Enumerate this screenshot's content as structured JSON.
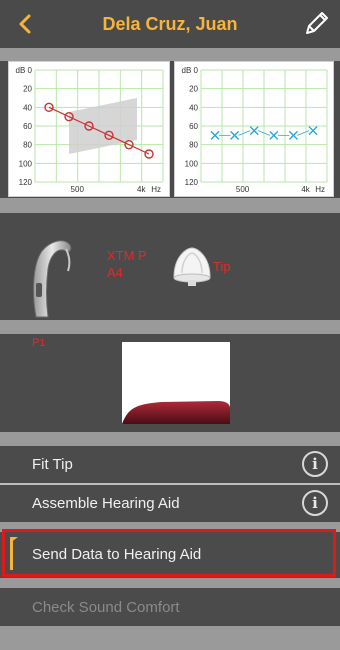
{
  "header": {
    "title": "Dela Cruz, Juan",
    "back_icon": "chevron-left-icon",
    "edit_icon": "pencil-icon",
    "accent": "#f6b43c"
  },
  "audiogram_left": {
    "y_ticks": [
      "dB 0",
      "20",
      "40",
      "60",
      "80",
      "100",
      "120"
    ],
    "x_ticks": [
      "500",
      "4k",
      "Hz"
    ],
    "marker": "circle",
    "color": "#cc3333",
    "points_db": [
      40,
      50,
      60,
      70,
      80,
      90
    ]
  },
  "audiogram_right": {
    "y_ticks": [
      "dB 0",
      "20",
      "40",
      "60",
      "80",
      "100",
      "120"
    ],
    "x_ticks": [
      "500",
      "4k",
      "Hz"
    ],
    "marker": "cross",
    "color": "#2aa8d8",
    "points_db": [
      70,
      70,
      65,
      70,
      70,
      65
    ]
  },
  "device": {
    "model_line1": "XTM P",
    "model_line2": "A4",
    "tip_label": "Tip"
  },
  "program": {
    "label": "P1"
  },
  "menu": {
    "items": [
      {
        "label": "Fit Tip",
        "info": "i"
      },
      {
        "label": "Assemble Hearing Aid",
        "info": "i"
      },
      {
        "label": "Send Data to Hearing Aid"
      },
      {
        "label": "Check Sound Comfort"
      }
    ]
  }
}
